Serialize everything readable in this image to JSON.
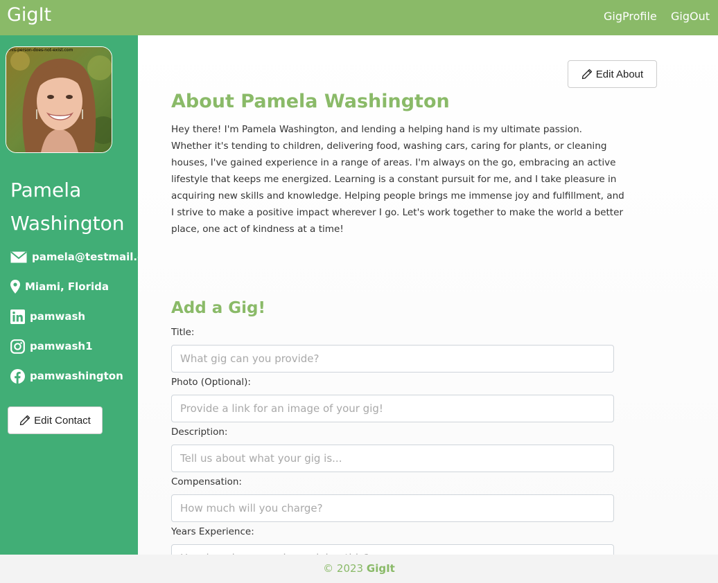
{
  "nav": {
    "brand": "GigIt",
    "links": [
      "GigProfile",
      "GigOut"
    ]
  },
  "sidebar": {
    "photo_caption": "this-person-does-not-exist.com",
    "name": "Pamela Washington",
    "contacts": {
      "email": "pamela@testmail.com",
      "location": "Miami, Florida",
      "linkedin": "pamwash",
      "instagram": "pamwash1",
      "facebook": "pamwashington"
    },
    "edit_contact_label": "Edit Contact"
  },
  "about": {
    "edit_label": "Edit About",
    "title": "About Pamela Washington",
    "text": "Hey there! I'm Pamela Washington, and lending a helping hand is my ultimate passion. Whether it's tending to children, delivering food, washing cars, caring for plants, or cleaning houses, I've gained experience in a range of areas. I'm always on the go, embracing an active lifestyle that keeps me energized. Learning is a constant pursuit for me, and I take pleasure in acquiring new skills and knowledge. Helping people brings me immense joy and fulfillment, and I strive to make a positive impact wherever I go. Let's work together to make the world a better place, one act of kindness at a time!"
  },
  "gig_form": {
    "title": "Add a Gig!",
    "fields": [
      {
        "label": "Title:",
        "placeholder": "What gig can you provide?"
      },
      {
        "label": "Photo (Optional):",
        "placeholder": "Provide a link for an image of your gig!"
      },
      {
        "label": "Description:",
        "placeholder": "Tell us about what your gig is..."
      },
      {
        "label": "Compensation:",
        "placeholder": "How much will you charge?"
      },
      {
        "label": "Years Experience:",
        "placeholder": "How long have you been doing this?"
      }
    ]
  },
  "footer": {
    "copyright": "© 2023",
    "brand": "GigIt"
  },
  "colors": {
    "nav_green": "#8aba68",
    "sidebar_green": "#41ae76",
    "heading_green": "#8aba68"
  }
}
